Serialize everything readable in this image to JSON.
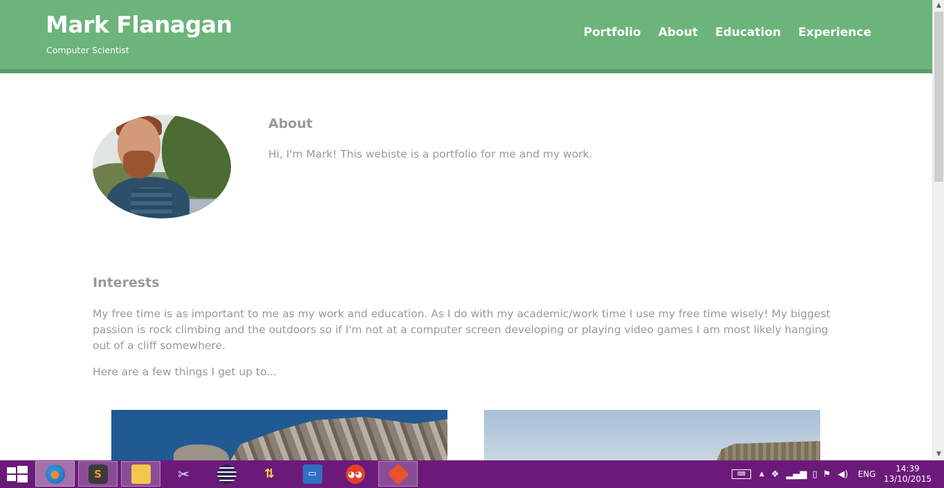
{
  "header": {
    "name": "Mark Flanagan",
    "tagline": "Computer Scientist",
    "nav": [
      "Portfolio",
      "About",
      "Education",
      "Experience"
    ]
  },
  "about": {
    "title": "About",
    "text": "Hi, I'm Mark! This webiste is a portfolio for me and my work."
  },
  "interests": {
    "title": "Interests",
    "text": "My free time is as important to me as my work and education. As I do with my academic/work time I use my free time wisely! My biggest passion is rock climbing and the outdoors so if I'm not at a computer screen developing or playing video games I am most likely hanging out of a cliff somewhere.",
    "more": "Here are a few things I get up to..."
  },
  "taskbar": {
    "apps": [
      "firefox",
      "sublime-text",
      "file-explorer",
      "snipping-tool",
      "eclipse",
      "network-tool",
      "remote-desktop",
      "owl-app",
      "git"
    ],
    "language": "ENG",
    "time": "14:39",
    "date": "13/10/2015"
  },
  "colors": {
    "header": "#6bb47a",
    "header_border": "#58a066",
    "text": "#999999",
    "taskbar": "#6b1a7a"
  }
}
